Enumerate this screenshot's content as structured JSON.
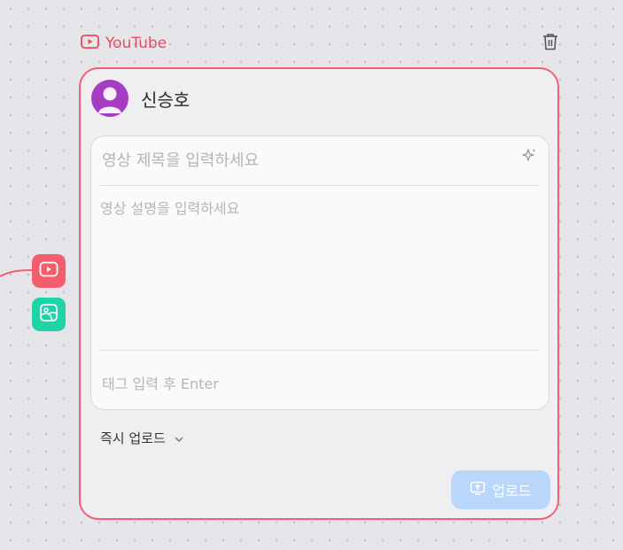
{
  "platform": {
    "label": "YouTube",
    "icon": "youtube-icon",
    "accent": "#f0475a"
  },
  "account": {
    "name": "신승호",
    "avatar_color": "#a63cc2"
  },
  "editor": {
    "title_placeholder": "영상 제목을 입력하세요",
    "description_placeholder": "영상 설명을 입력하세요",
    "tag_placeholder": "태그 입력 후 Enter"
  },
  "schedule": {
    "selected": "즉시 업로드"
  },
  "actions": {
    "upload_label": "업로드",
    "upload_color": "#b9d6fb"
  },
  "side_buttons": [
    {
      "icon": "youtube-icon",
      "color": "#f45d6d"
    },
    {
      "icon": "image-icon",
      "color": "#1ed3a6"
    }
  ],
  "card": {
    "border_color": "#f26173"
  }
}
